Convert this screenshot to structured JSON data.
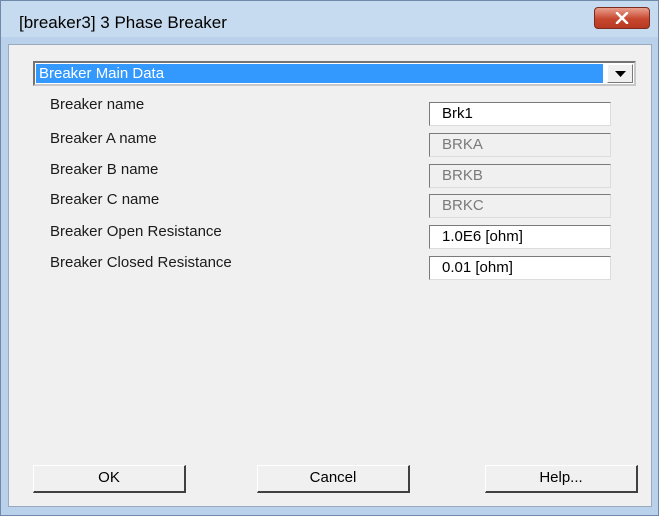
{
  "window": {
    "title": "[breaker3] 3 Phase Breaker"
  },
  "section_select": {
    "selected": "Breaker Main Data"
  },
  "fields": [
    {
      "label": "Breaker name",
      "value": "Brk1",
      "enabled": true
    },
    {
      "label": "Breaker A name",
      "value": "BRKA",
      "enabled": false
    },
    {
      "label": "Breaker B name",
      "value": "BRKB",
      "enabled": false
    },
    {
      "label": "Breaker C name",
      "value": "BRKC",
      "enabled": false
    },
    {
      "label": "Breaker Open Resistance",
      "value": "1.0E6 [ohm]",
      "enabled": true
    },
    {
      "label": "Breaker Closed  Resistance",
      "value": "0.01 [ohm]",
      "enabled": true
    }
  ],
  "buttons": {
    "ok": "OK",
    "cancel": "Cancel",
    "help": "Help..."
  },
  "icons": {
    "close": "close-icon",
    "dropdown": "chevron-down-icon"
  },
  "colors": {
    "selection": "#3399ff",
    "close_button": "#c7472f"
  }
}
